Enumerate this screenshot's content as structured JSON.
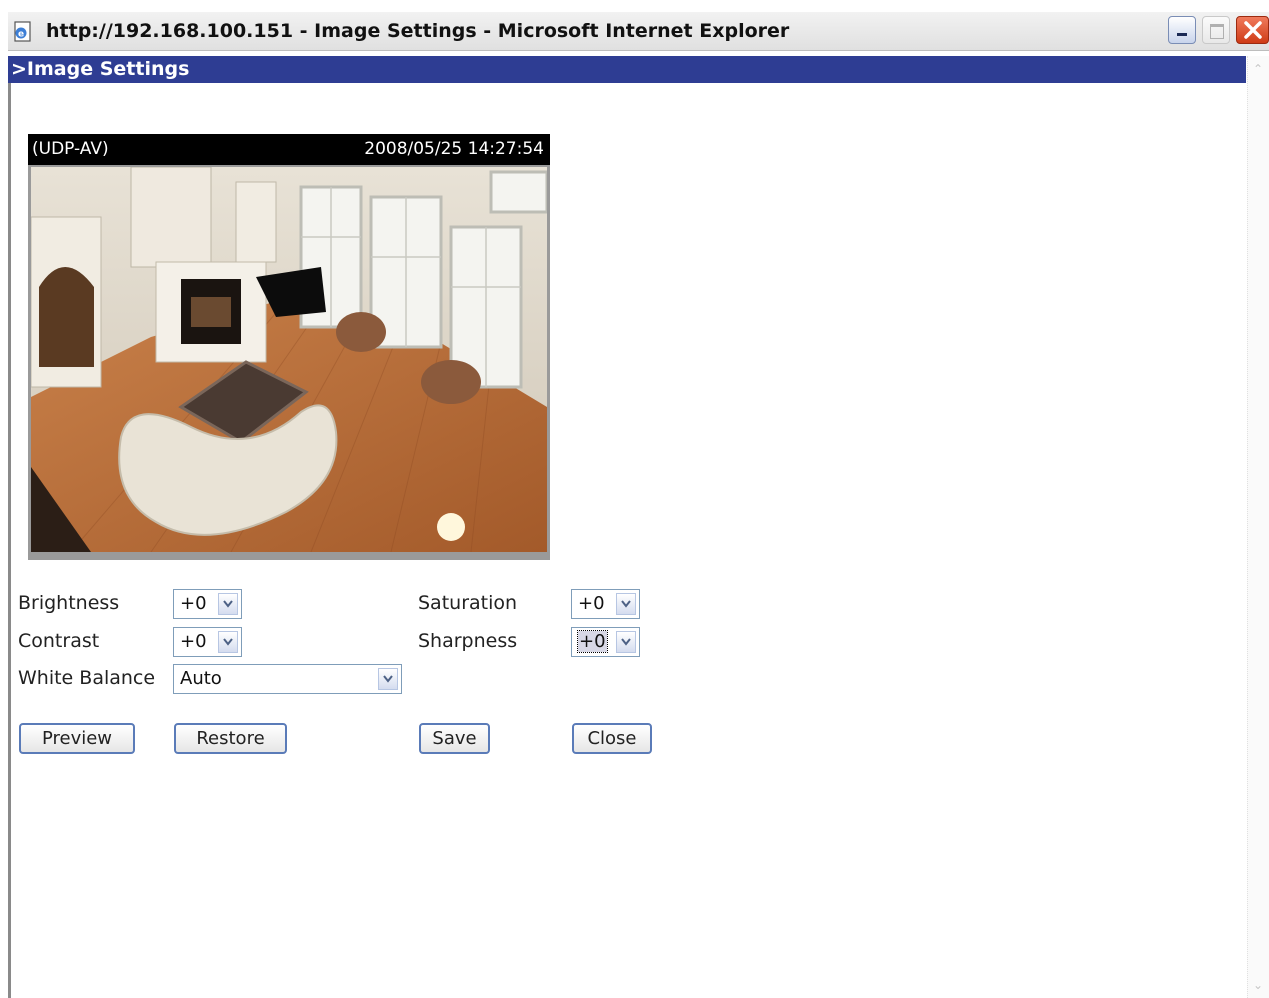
{
  "window": {
    "title": "http://192.168.100.151 - Image Settings - Microsoft Internet Explorer",
    "icon": "ie-page-icon",
    "controls": [
      "minimize-icon",
      "maximize-icon",
      "close-icon"
    ]
  },
  "page": {
    "header": ">Image Settings"
  },
  "camera": {
    "protocol": "(UDP-AV)",
    "timestamp": "2008/05/25 14:27:54"
  },
  "settings": {
    "brightness": {
      "label": "Brightness",
      "value": "+0"
    },
    "saturation": {
      "label": "Saturation",
      "value": "+0"
    },
    "contrast": {
      "label": "Contrast",
      "value": "+0"
    },
    "sharpness": {
      "label": "Sharpness",
      "value": "+0"
    },
    "white_balance": {
      "label": "White Balance",
      "value": "Auto"
    }
  },
  "buttons": {
    "preview": "Preview",
    "restore": "Restore",
    "save": "Save",
    "close": "Close"
  },
  "colors": {
    "header_band": "#2e3d93",
    "close_button": "#d9481f",
    "button_border": "#5a7bb8"
  }
}
